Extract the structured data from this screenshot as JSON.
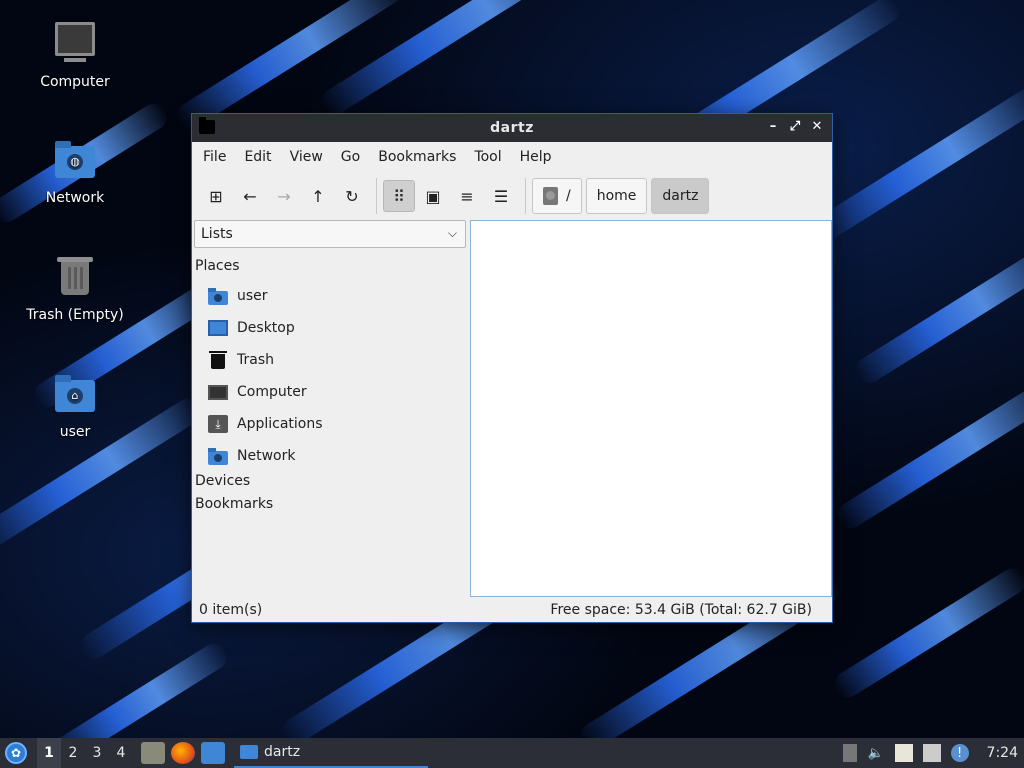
{
  "desktop": {
    "icons": [
      {
        "label": "Computer"
      },
      {
        "label": "Network"
      },
      {
        "label": "Trash (Empty)"
      },
      {
        "label": "user"
      }
    ]
  },
  "window": {
    "title": "dartz",
    "menu": [
      "File",
      "Edit",
      "View",
      "Go",
      "Bookmarks",
      "Tool",
      "Help"
    ],
    "breadcrumb": [
      "/",
      "home",
      "dartz"
    ],
    "sidebar": {
      "selector": "Lists",
      "places_header": "Places",
      "places": [
        "user",
        "Desktop",
        "Trash",
        "Computer",
        "Applications",
        "Network"
      ],
      "devices_header": "Devices",
      "bookmarks_header": "Bookmarks"
    },
    "status": {
      "items": "0 item(s)",
      "free_space": "Free space: 53.4 GiB (Total: 62.7 GiB)"
    }
  },
  "taskbar": {
    "workspaces": [
      "1",
      "2",
      "3",
      "4"
    ],
    "active_workspace": "1",
    "task_title": "dartz",
    "clock": "7:24"
  },
  "colors": {
    "accent": "#3f86d6",
    "titlebar": "#2b2d33",
    "taskbar": "#2b2e36"
  }
}
